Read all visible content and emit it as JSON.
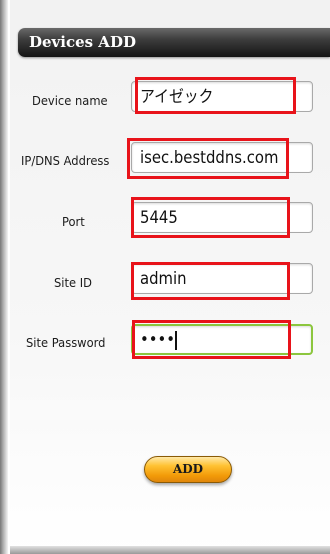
{
  "header": {
    "title": "Devices ADD"
  },
  "form": {
    "fields": [
      {
        "label": "Device name",
        "value": "アイゼック"
      },
      {
        "label": "IP/DNS Address",
        "value": "isec.bestddns.com"
      },
      {
        "label": "Port",
        "value": "5445"
      },
      {
        "label": "Site ID",
        "value": "admin"
      },
      {
        "label": "Site Password",
        "value": "••••"
      }
    ]
  },
  "actions": {
    "add_label": "ADD"
  },
  "colors": {
    "highlight": "#e8131a",
    "focus_border": "#8cc63e",
    "button": "#f4a20e"
  }
}
